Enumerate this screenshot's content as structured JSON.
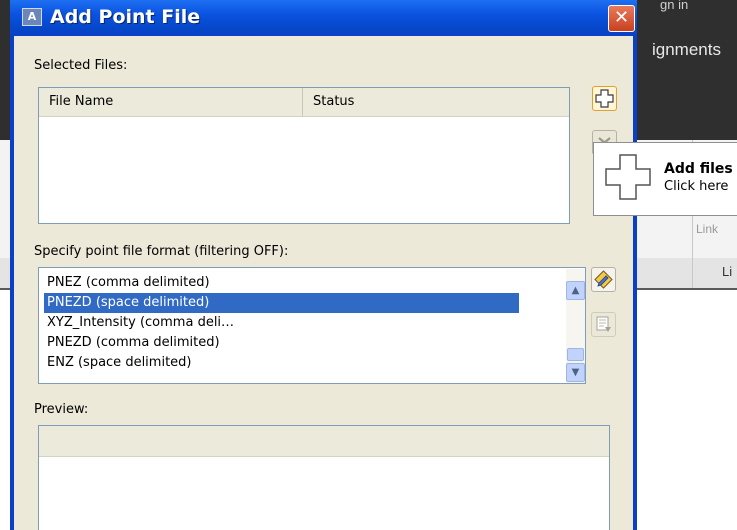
{
  "background": {
    "top_sign": "gn in",
    "ribbon_text": "ignments",
    "link_text": "Link",
    "bottom_text": "Li"
  },
  "dialog": {
    "title": "Add Point File",
    "close_glyph": "✕",
    "selected_files_label": "Selected Files:",
    "files_table": {
      "columns": [
        "File Name",
        "Status"
      ],
      "rows": []
    },
    "format_label": "Specify point file format (filtering OFF):",
    "formats": [
      "PNEZ (comma delimited)",
      "PNEZD (space delimited)",
      "XYZ_Intensity (comma deli…",
      "PNEZD (comma delimited)",
      "ENZ (space delimited)"
    ],
    "selected_format": "PNEZD (space delimited)",
    "preview_label": "Preview:"
  },
  "tooltip": {
    "title": "Add files",
    "subtitle": "Click here"
  },
  "icons": {
    "add_files": "plus-icon",
    "remove_files": "remove-icon",
    "edit_format": "format-edit-icon",
    "format_manager": "format-manager-icon"
  },
  "colors": {
    "title_bar": "#0a52e0",
    "selection": "#316ac5",
    "close_button": "#c8401f",
    "dialog_face": "#ece9d8"
  }
}
